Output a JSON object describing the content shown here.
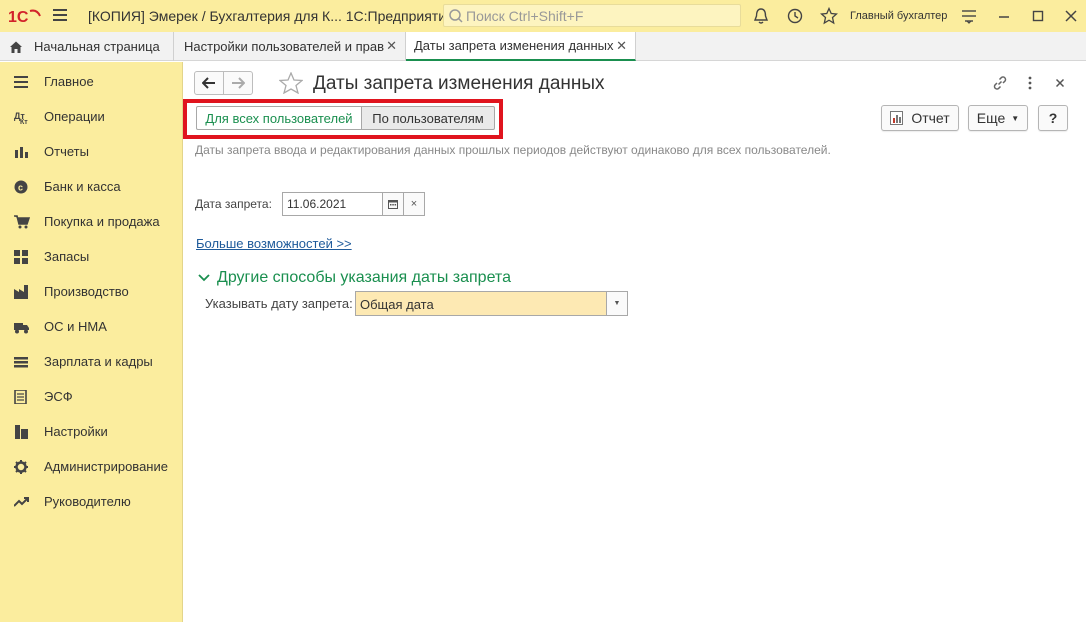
{
  "titlebar": {
    "app_title": "[КОПИЯ] Эмерек / Бухгалтерия для К... 1С:Предприятие",
    "search_placeholder": "Поиск Ctrl+Shift+F",
    "user_name": "Главный бухгалтер"
  },
  "tabs": [
    {
      "label": "Начальная страница"
    },
    {
      "label": "Настройки пользователей и прав"
    },
    {
      "label": "Даты запрета изменения данных"
    }
  ],
  "sidebar": {
    "items": [
      {
        "label": "Главное",
        "icon": "list-icon"
      },
      {
        "label": "Операции",
        "icon": "operations-icon"
      },
      {
        "label": "Отчеты",
        "icon": "bar-chart-icon"
      },
      {
        "label": "Банк и касса",
        "icon": "coin-icon"
      },
      {
        "label": "Покупка и продажа",
        "icon": "cart-icon"
      },
      {
        "label": "Запасы",
        "icon": "grid-icon"
      },
      {
        "label": "Производство",
        "icon": "factory-icon"
      },
      {
        "label": "ОС и НМА",
        "icon": "truck-icon"
      },
      {
        "label": "Зарплата и кадры",
        "icon": "people-icon"
      },
      {
        "label": "ЭСФ",
        "icon": "document-icon"
      },
      {
        "label": "Настройки",
        "icon": "building-icon"
      },
      {
        "label": "Администрирование",
        "icon": "gear-icon"
      },
      {
        "label": "Руководителю",
        "icon": "trend-icon"
      }
    ]
  },
  "form": {
    "title": "Даты запрета изменения данных",
    "mode_all": "Для всех пользователей",
    "mode_users": "По пользователям",
    "report_label": "Отчет",
    "more_label": "Еще",
    "help_label": "?",
    "description": "Даты запрета ввода и редактирования данных прошлых периодов действуют одинаково для всех пользователей.",
    "date_label": "Дата запрета:",
    "date_value": "11.06.2021",
    "clear_label": "×",
    "more_link": "Больше возможностей >>",
    "group_title": "Другие способы указания даты запрета",
    "spec_label": "Указывать дату запрета:",
    "spec_value": "Общая дата"
  },
  "colors": {
    "accent_green": "#1a8f4f",
    "panel_yellow": "#fbed9e",
    "highlight_red": "#e0141e",
    "link_blue": "#1e5a9a"
  }
}
